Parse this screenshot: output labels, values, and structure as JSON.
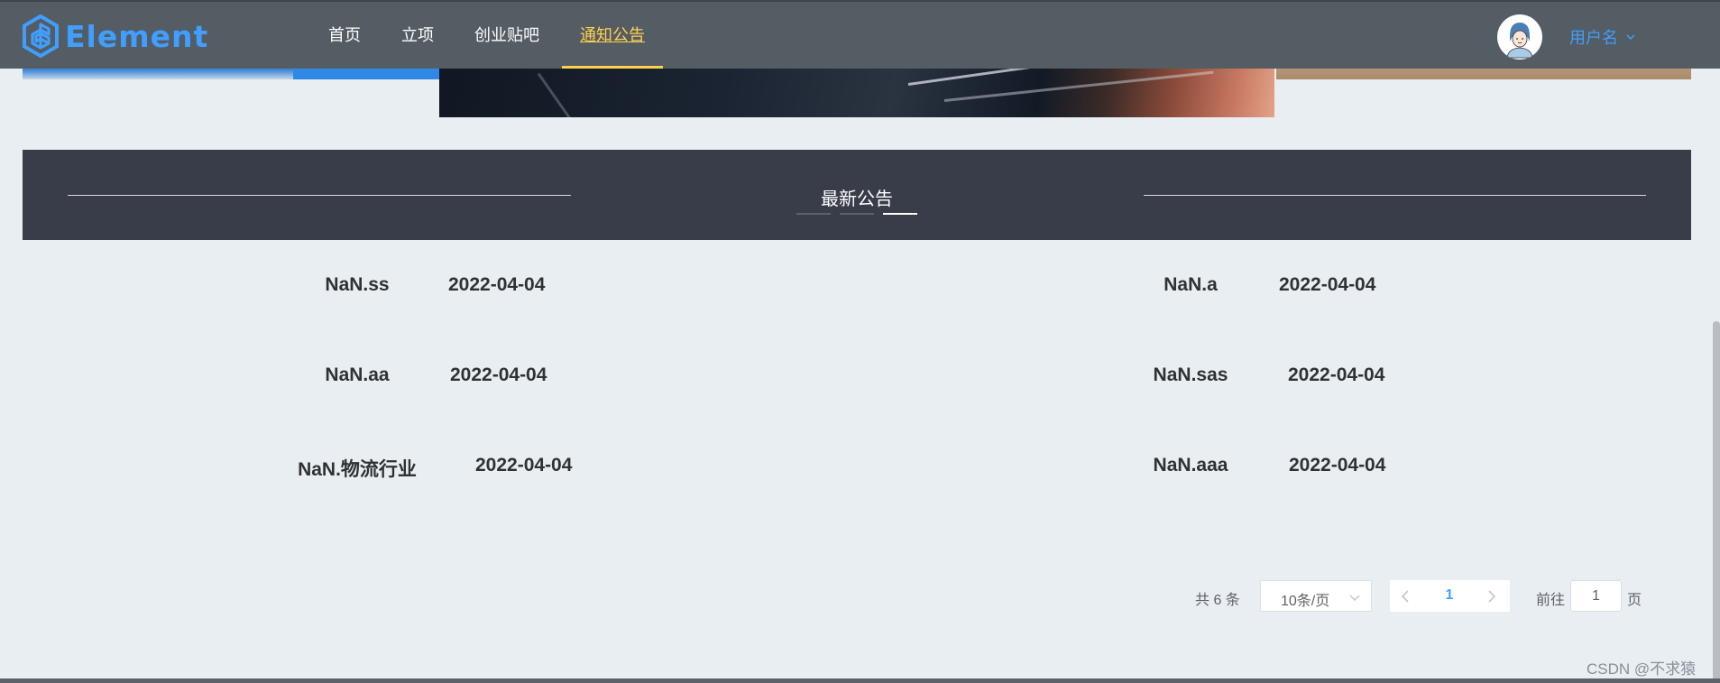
{
  "brand": {
    "name": "Element",
    "icon": "element-logo-icon",
    "color": "#409eff"
  },
  "nav": {
    "items": [
      {
        "label": "首页",
        "active": false
      },
      {
        "label": "立项",
        "active": false
      },
      {
        "label": "创业贴吧",
        "active": false
      },
      {
        "label": "通知公告",
        "active": true
      }
    ],
    "active_color": "#ffd04b",
    "background": "#545c64"
  },
  "user": {
    "name": "用户名",
    "avatar_icon": "user-avatar-icon",
    "dropdown_icon": "chevron-down-icon"
  },
  "banner": {
    "title": "最新公告",
    "background": "#393d49"
  },
  "notices": {
    "left": [
      {
        "title": "NaN.ss",
        "date": "2022-04-04"
      },
      {
        "title": "NaN.aa",
        "date": "2022-04-04"
      },
      {
        "title": "NaN.物流行业",
        "date": "2022-04-04"
      }
    ],
    "right": [
      {
        "title": "NaN.a",
        "date": "2022-04-04"
      },
      {
        "title": "NaN.sas",
        "date": "2022-04-04"
      },
      {
        "title": "NaN.aaa",
        "date": "2022-04-04"
      }
    ]
  },
  "pagination": {
    "total_text": "共 6 条",
    "page_size": "10条/页",
    "current_page": "1",
    "goto_label": "前往",
    "goto_value": "1",
    "goto_unit": "页"
  },
  "watermark": "CSDN @不求猿"
}
